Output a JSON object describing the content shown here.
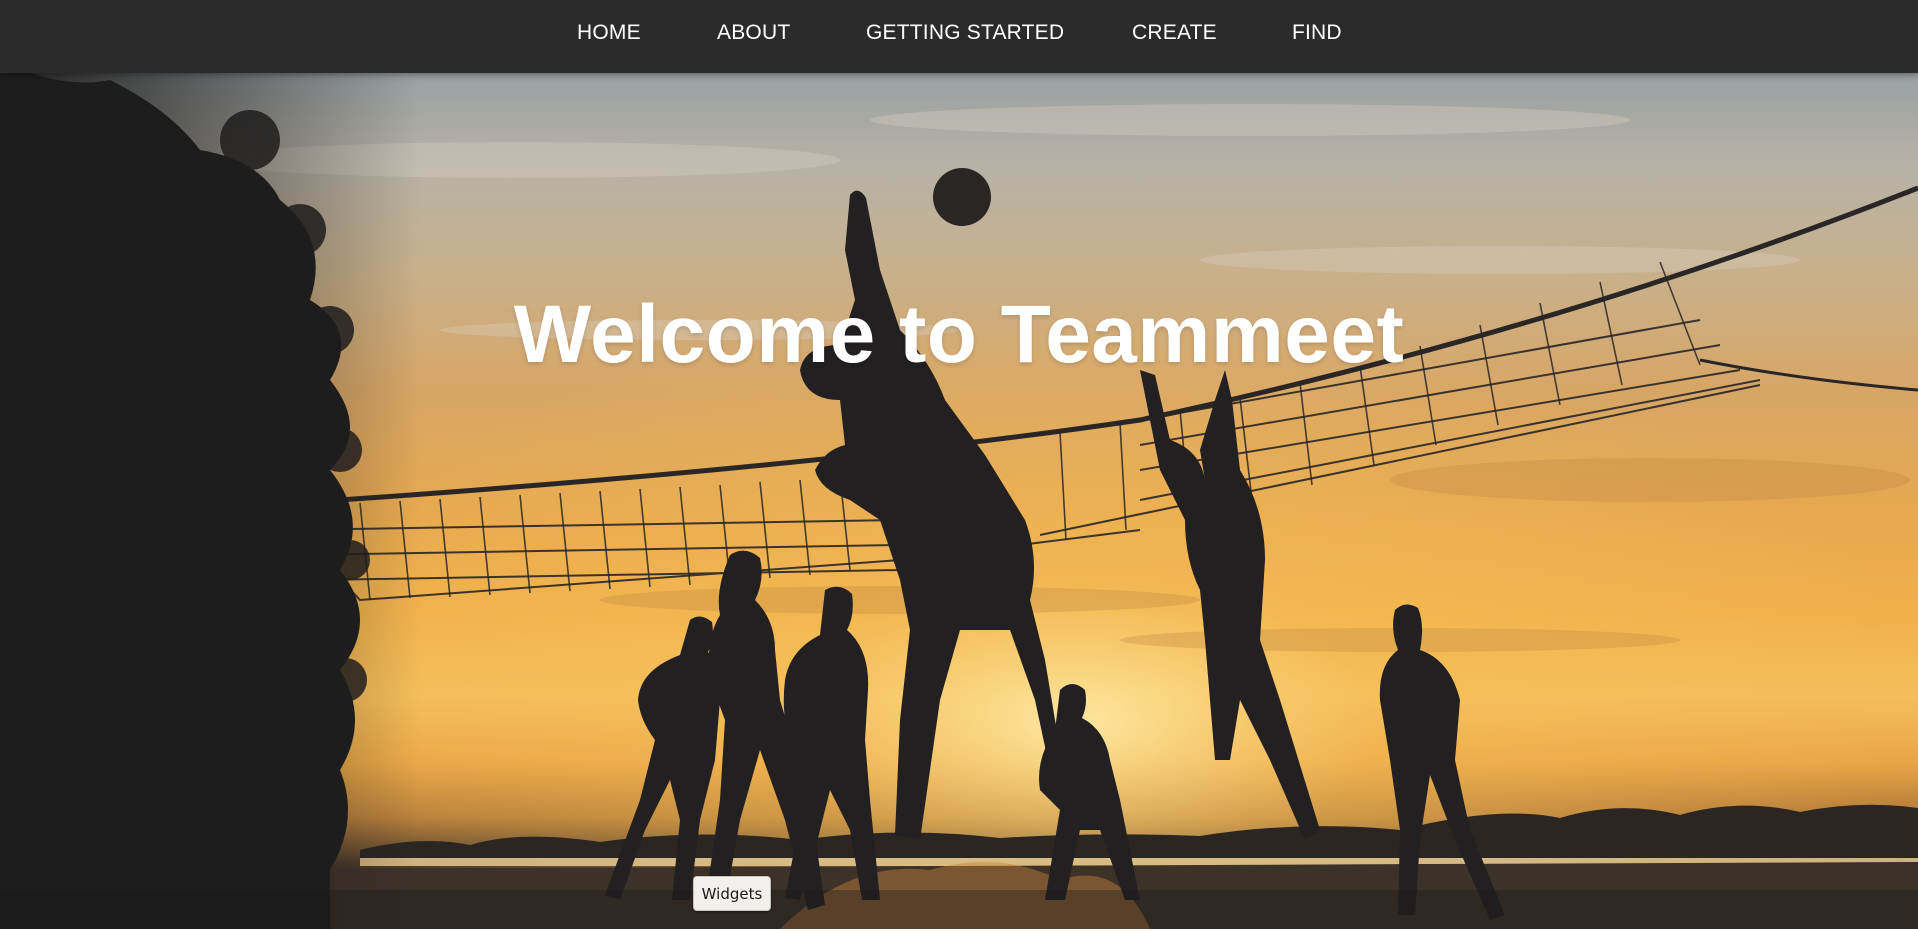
{
  "navbar": {
    "items": [
      {
        "label": "HOME"
      },
      {
        "label": "ABOUT"
      },
      {
        "label": "GETTING STARTED"
      },
      {
        "label": "CREATE"
      },
      {
        "label": "FIND"
      }
    ]
  },
  "hero": {
    "title": "Welcome to Teammeet",
    "image_icon": "beach-volleyball-sunset-photo"
  },
  "widgets_button": {
    "label": "Widgets"
  },
  "colors": {
    "navbar_bg": "#2b2b2b",
    "nav_text": "#ffffff",
    "title_text": "#ffffff",
    "sky_top": "#7f8891",
    "sunset": "#f0b04a",
    "silhouette": "#222021"
  }
}
